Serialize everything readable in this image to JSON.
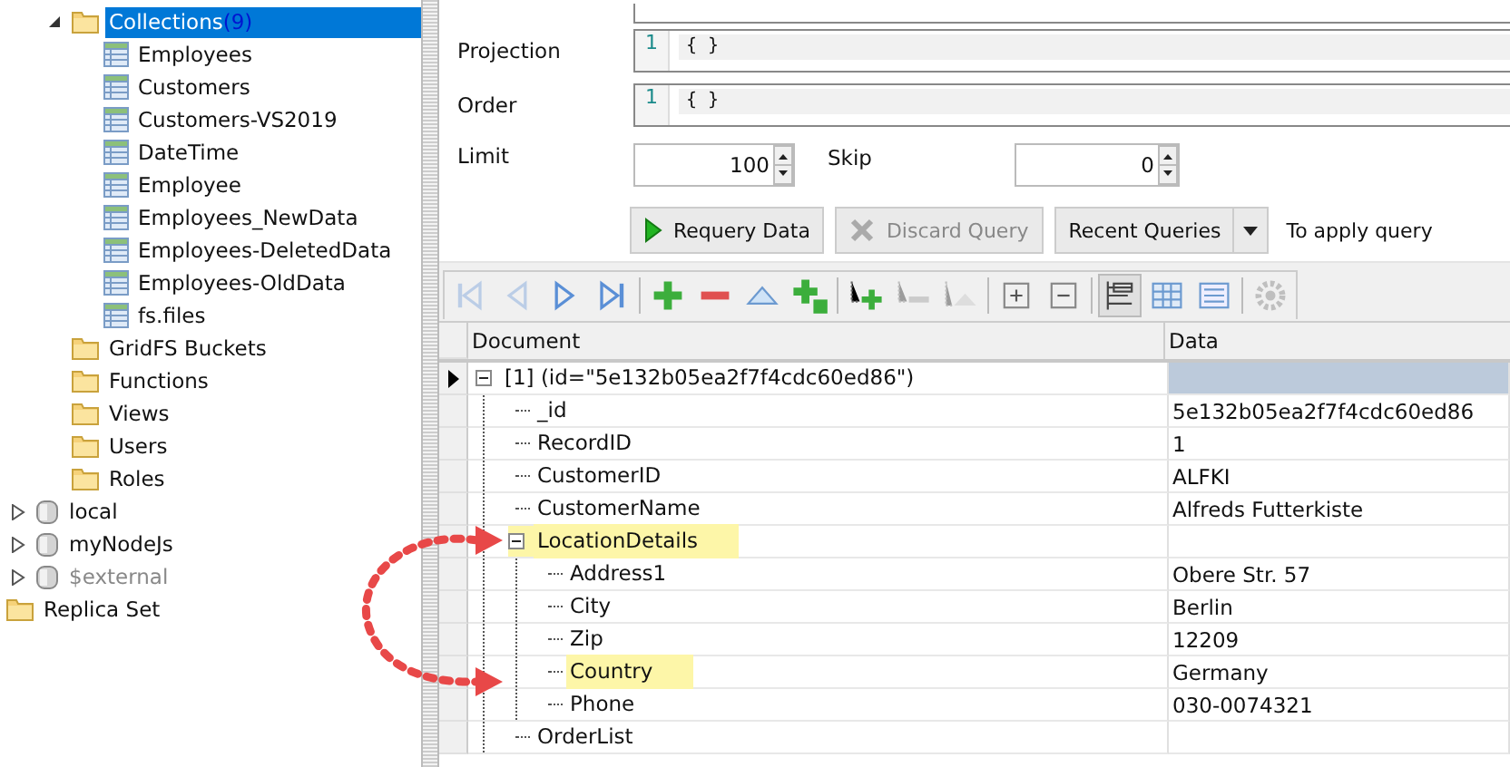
{
  "tree": {
    "folders": [
      {
        "label": "Collections",
        "count": "(9)",
        "expanded": true,
        "selected": true,
        "children": [
          {
            "label": "Employees"
          },
          {
            "label": "Customers"
          },
          {
            "label": "Customers-VS2019"
          },
          {
            "label": "DateTime"
          },
          {
            "label": "Employee"
          },
          {
            "label": "Employees_NewData"
          },
          {
            "label": "Employees-DeletedData"
          },
          {
            "label": "Employees-OldData"
          },
          {
            "label": "fs.files"
          }
        ]
      },
      {
        "label": "GridFS Buckets",
        "selected": false
      },
      {
        "label": "Functions",
        "selected": false
      },
      {
        "label": "Views",
        "selected": false
      },
      {
        "label": "Users",
        "selected": false
      },
      {
        "label": "Roles",
        "selected": false
      }
    ],
    "databases": [
      {
        "label": "local",
        "expanded": false,
        "disabled": false
      },
      {
        "label": "myNodeJs",
        "expanded": false,
        "disabled": false
      },
      {
        "label": "$external",
        "expanded": false,
        "disabled": true
      }
    ],
    "root_items": [
      {
        "label": "Replica Set"
      }
    ]
  },
  "query_form": {
    "fields": [
      {
        "label": "Projection",
        "line_number": "1",
        "value": "{ }"
      },
      {
        "label": "Order",
        "line_number": "1",
        "value": "{ }"
      }
    ],
    "limit": {
      "label": "Limit",
      "value": "100"
    },
    "skip": {
      "label": "Skip",
      "value": "0"
    },
    "buttons": [
      {
        "label": "Requery Data",
        "kind": "run",
        "disabled": false
      },
      {
        "label": "Discard Query",
        "kind": "discard",
        "disabled": true
      },
      {
        "label": "Recent Queries",
        "kind": "dropdown",
        "disabled": false
      }
    ],
    "hint": "To apply query"
  },
  "toolbar": [
    {
      "kind": "first",
      "disabled": true
    },
    {
      "kind": "prev",
      "disabled": true
    },
    {
      "kind": "next",
      "disabled": false
    },
    {
      "kind": "last",
      "disabled": false
    },
    {
      "kind": "sep"
    },
    {
      "kind": "add",
      "disabled": false
    },
    {
      "kind": "remove",
      "disabled": false
    },
    {
      "kind": "up",
      "disabled": false
    },
    {
      "kind": "add2",
      "disabled": false
    },
    {
      "kind": "sep"
    },
    {
      "kind": "add-child",
      "disabled": false
    },
    {
      "kind": "remove-child",
      "disabled": true
    },
    {
      "kind": "up-child",
      "disabled": true
    },
    {
      "kind": "sep"
    },
    {
      "kind": "expand",
      "disabled": false
    },
    {
      "kind": "collapse",
      "disabled": false
    },
    {
      "kind": "sep"
    },
    {
      "kind": "tree-view",
      "pressed": true
    },
    {
      "kind": "table-view",
      "pressed": false
    },
    {
      "kind": "text-view",
      "pressed": false
    },
    {
      "kind": "sep"
    },
    {
      "kind": "settings",
      "disabled": true
    }
  ],
  "grid": {
    "columns": [
      "Document",
      "Data"
    ],
    "records": [
      {
        "field": "[1] (id=\"5e132b05ea2f7f4cdc60ed86\")",
        "selected": true,
        "expanded": true,
        "children": [
          {
            "field": "_id",
            "value": "5e132b05ea2f7f4cdc60ed86"
          },
          {
            "field": "RecordID",
            "value": "1"
          },
          {
            "field": "CustomerID",
            "value": "ALFKI"
          },
          {
            "field": "CustomerName",
            "value": "Alfreds Futterkiste"
          },
          {
            "field": "LocationDetails",
            "expanded": true,
            "highlighted": true,
            "children": [
              {
                "field": "Address1",
                "value": "Obere Str. 57"
              },
              {
                "field": "City",
                "value": "Berlin"
              },
              {
                "field": "Zip",
                "value": "12209"
              },
              {
                "field": "Country",
                "value": "Germany",
                "highlighted": true
              },
              {
                "field": "Phone",
                "value": "030-0074321"
              }
            ]
          },
          {
            "field": "OrderList"
          }
        ]
      }
    ]
  }
}
